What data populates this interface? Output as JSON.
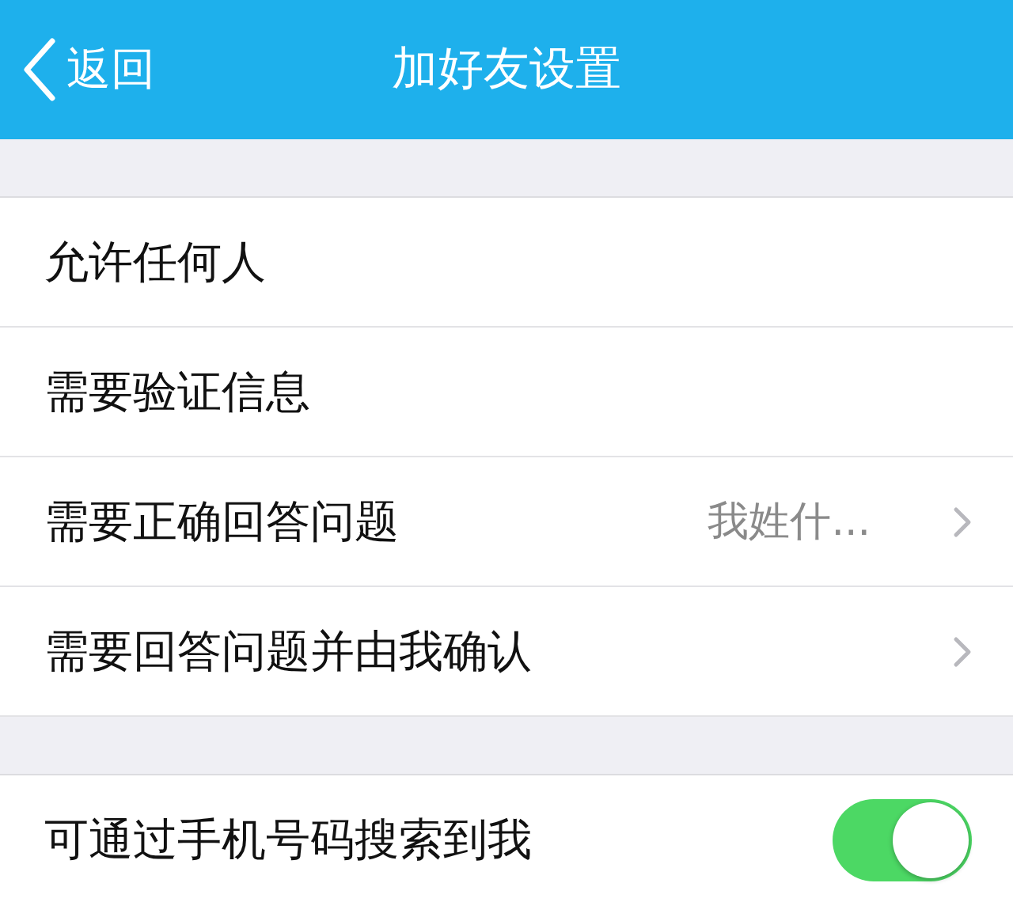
{
  "nav": {
    "back": "返回",
    "title": "加好友设置"
  },
  "options": [
    {
      "label": "允许任何人",
      "kind": "plain"
    },
    {
      "label": "需要验证信息",
      "kind": "plain"
    },
    {
      "label": "需要正确回答问题",
      "kind": "link",
      "value": "我姓什..."
    },
    {
      "label": "需要回答问题并由我确认",
      "kind": "link"
    }
  ],
  "settings": [
    {
      "label": "可通过手机号码搜索到我",
      "on": true
    }
  ]
}
